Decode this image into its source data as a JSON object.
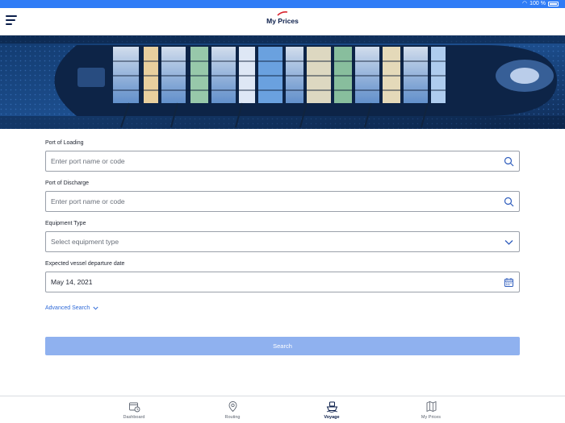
{
  "status_bar": {
    "battery": "100 %"
  },
  "header": {
    "title": "My Prices"
  },
  "form": {
    "port_of_loading": {
      "label": "Port of Loading",
      "placeholder": "Enter port name or code"
    },
    "port_of_discharge": {
      "label": "Port of Discharge",
      "placeholder": "Enter port name or code"
    },
    "equipment_type": {
      "label": "Equipment Type",
      "selected": "Select equipment type"
    },
    "departure_date": {
      "label": "Expected vessel departure date",
      "value": "May 14, 2021"
    },
    "advanced_search_label": "Advanced Search",
    "search_label": "Search"
  },
  "tabs": [
    {
      "label": "Dashboard",
      "icon": "dashboard-icon"
    },
    {
      "label": "Routing",
      "icon": "location-pin-icon"
    },
    {
      "label": "Voyage",
      "icon": "ship-icon"
    },
    {
      "label": "My Prices",
      "icon": "map-icon"
    }
  ],
  "colors": {
    "accent": "#2f7cf6",
    "brand_navy": "#0b1e4a",
    "button_disabled": "#8fb1ef",
    "link": "#2f6ad8",
    "brand_red": "#d9232e"
  }
}
